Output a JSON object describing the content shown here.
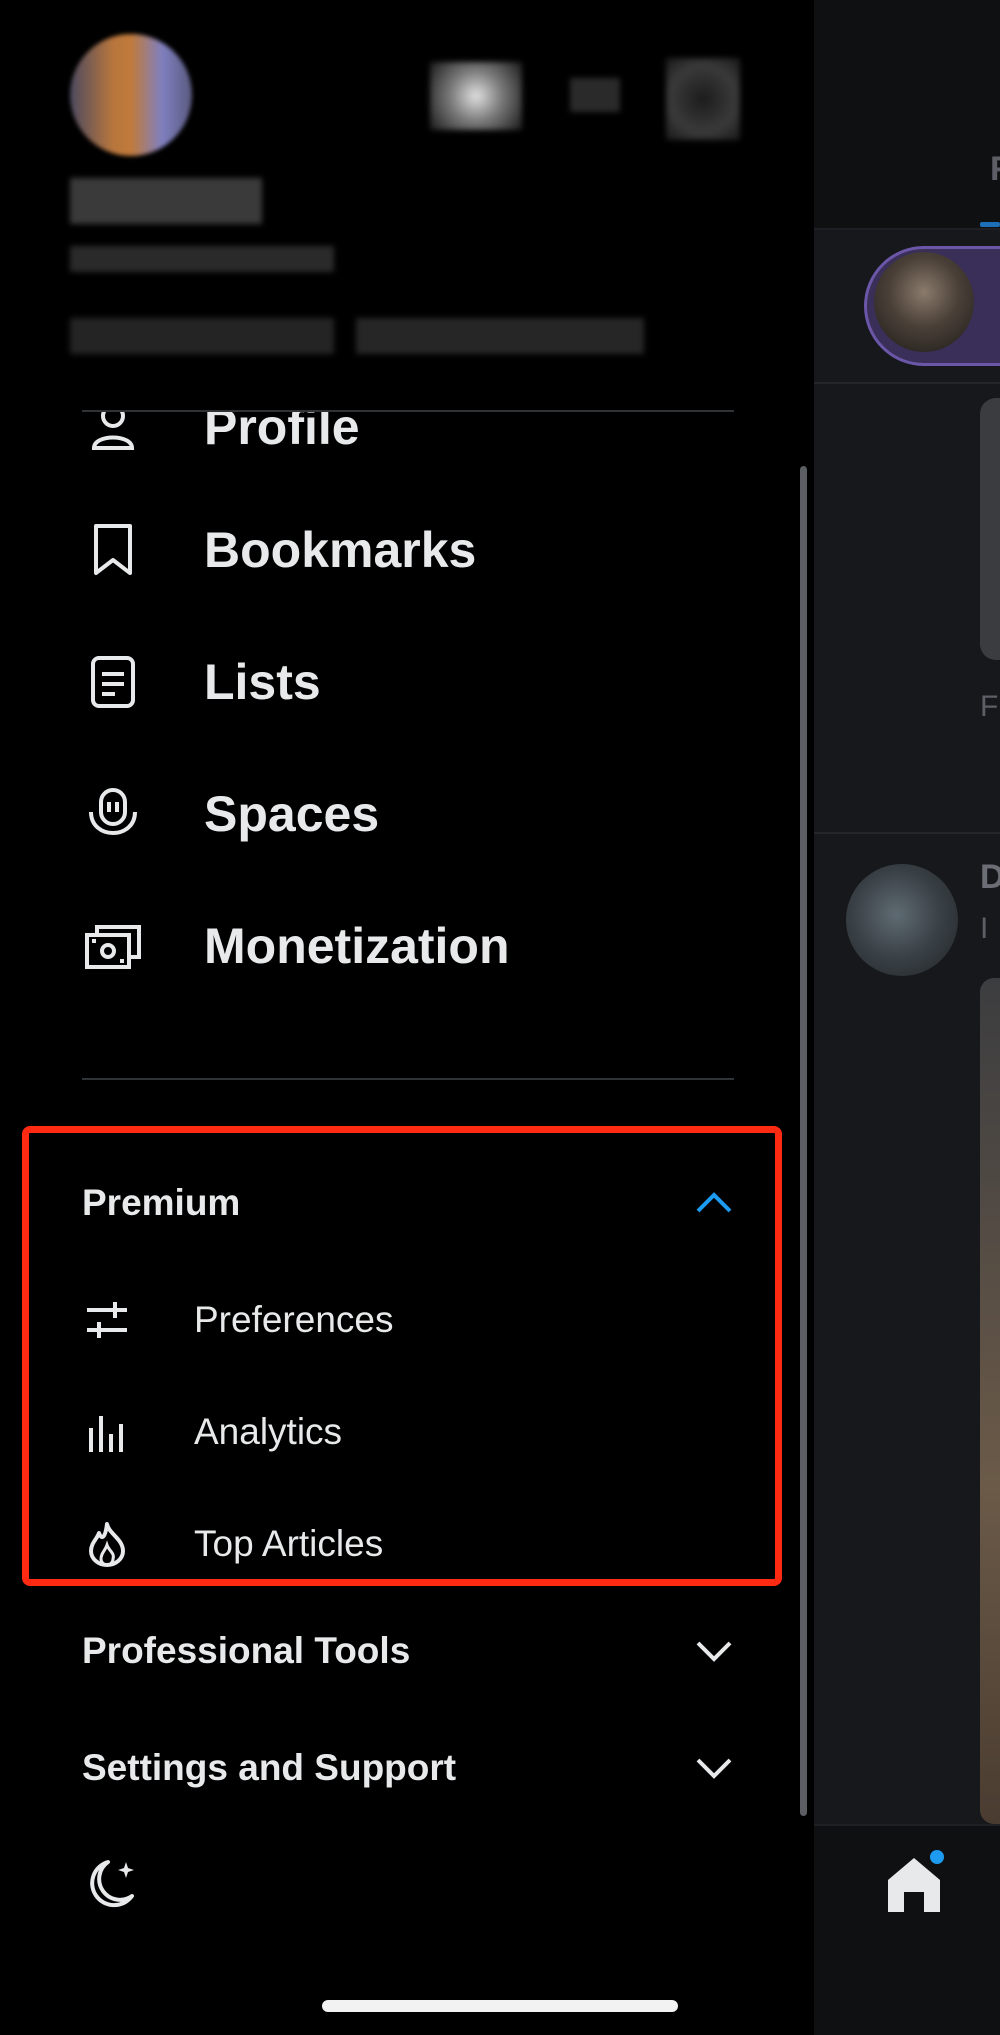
{
  "drawer": {
    "nav_items": [
      {
        "label": "Profile",
        "icon": "person-icon"
      },
      {
        "label": "Bookmarks",
        "icon": "bookmark-icon"
      },
      {
        "label": "Lists",
        "icon": "list-icon"
      },
      {
        "label": "Spaces",
        "icon": "spaces-icon"
      },
      {
        "label": "Monetization",
        "icon": "money-icon"
      }
    ],
    "premium": {
      "title": "Premium",
      "expanded": true,
      "items": [
        {
          "label": "Preferences",
          "icon": "sliders-icon"
        },
        {
          "label": "Analytics",
          "icon": "bar-chart-icon"
        },
        {
          "label": "Top Articles",
          "icon": "flame-icon"
        }
      ]
    },
    "professional_tools": {
      "title": "Professional Tools",
      "expanded": false
    },
    "settings_support": {
      "title": "Settings and Support",
      "expanded": false
    },
    "theme_toggle_icon": "moon-icon"
  },
  "timeline": {
    "tab_fragment": "F",
    "post_fragments": [
      "F",
      "D",
      "I"
    ],
    "home_icon": "home-icon",
    "notification_dot_color": "#1d9bf0"
  },
  "colors": {
    "accent": "#1d9bf0",
    "highlight_box": "#ff2a12",
    "background": "#000000",
    "text": "#e7e9ea"
  }
}
